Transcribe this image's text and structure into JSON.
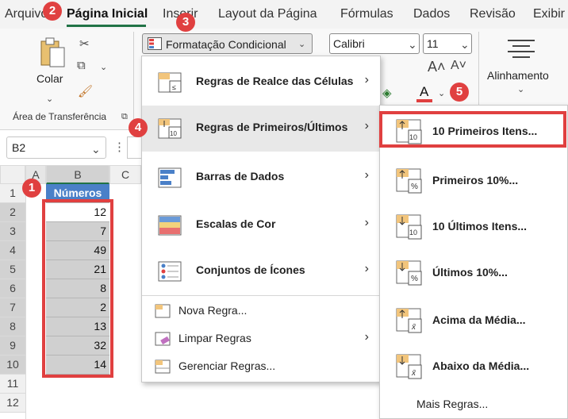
{
  "tabs": [
    {
      "label": "Arquivo"
    },
    {
      "label": "Página Inicial"
    },
    {
      "label": "Inserir"
    },
    {
      "label": "Layout da Página"
    },
    {
      "label": "Fórmulas"
    },
    {
      "label": "Dados"
    },
    {
      "label": "Revisão"
    },
    {
      "label": "Exibir"
    }
  ],
  "ribbon": {
    "paste_label": "Colar",
    "clipboard_group": "Área de Transferência",
    "cond_format_label": "Formatação Condicional",
    "font_name": "Calibri",
    "font_size": "11",
    "alignment_label": "Alinhamento"
  },
  "formula_bar": {
    "name_box": "B2"
  },
  "sheet": {
    "columns": [
      "A",
      "B",
      "C"
    ],
    "rows": [
      "1",
      "2",
      "3",
      "4",
      "5",
      "6",
      "7",
      "8",
      "9",
      "10",
      "11",
      "12"
    ],
    "header": "Números",
    "values": [
      "12",
      "7",
      "49",
      "21",
      "8",
      "2",
      "13",
      "32",
      "14"
    ]
  },
  "menu": {
    "items": [
      {
        "label": "Regras de Realce das Células"
      },
      {
        "label": "Regras de Primeiros/Últimos"
      },
      {
        "label": "Barras de Dados"
      },
      {
        "label": "Escalas de Cor"
      },
      {
        "label": "Conjuntos de Ícones"
      }
    ],
    "small_items": [
      {
        "label": "Nova Regra..."
      },
      {
        "label": "Limpar Regras"
      },
      {
        "label": "Gerenciar Regras..."
      }
    ]
  },
  "submenu": {
    "items": [
      {
        "label": "10 Primeiros Itens..."
      },
      {
        "label": "Primeiros 10%..."
      },
      {
        "label": "10 Últimos Itens..."
      },
      {
        "label": "Últimos 10%..."
      },
      {
        "label": "Acima da Média..."
      },
      {
        "label": "Abaixo da Média..."
      }
    ],
    "more": "Mais Regras..."
  },
  "badges": [
    "1",
    "2",
    "3",
    "4",
    "5"
  ],
  "colors": {
    "accent": "#217346",
    "highlight": "#e04040",
    "header_fill": "#4a80c8"
  }
}
